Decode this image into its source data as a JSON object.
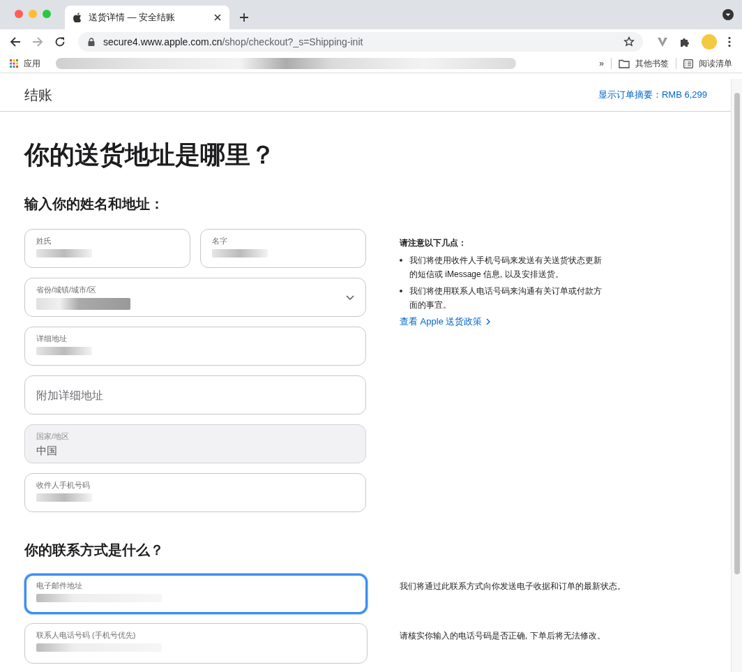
{
  "browser": {
    "tab": {
      "title": "送货详情 — 安全结账",
      "selected": true
    },
    "url": {
      "host": "secure4.www.apple.com.cn",
      "path": "/shop/checkout?_s=Shipping-init"
    },
    "bookmarks": {
      "apps": "应用",
      "overflow": "»",
      "other": "其他书签",
      "reading_list": "阅读清单"
    }
  },
  "header": {
    "title": "结账",
    "summary_link": "显示订单摘要：RMB 6,299"
  },
  "page_title": "你的送货地址是哪里？",
  "address_section": {
    "heading": "输入你的姓名和地址：",
    "name_fields": [
      {
        "label": "姓氏",
        "redacted": true,
        "focused": false,
        "disabled": false
      },
      {
        "label": "名字",
        "redacted": true,
        "focused": false,
        "disabled": false
      }
    ],
    "fields": [
      {
        "label": "省份/城镇/城市/区",
        "kind": "select",
        "redacted": true,
        "focused": false,
        "disabled": false
      },
      {
        "label": "详细地址",
        "kind": "text",
        "redacted": true,
        "focused": false,
        "disabled": false
      },
      {
        "placeholder": "附加详细地址",
        "kind": "text",
        "redacted": false,
        "focused": false,
        "disabled": false
      },
      {
        "label": "国家/地区",
        "value": "中国",
        "kind": "text",
        "redacted": false,
        "focused": false,
        "disabled": true
      },
      {
        "label": "收件人手机号码",
        "kind": "text",
        "redacted": true,
        "focused": false,
        "disabled": false
      }
    ],
    "notes": {
      "heading": "请注意以下几点：",
      "items": [
        "我们将使用收件人手机号码来发送有关送货状态更新的短信或 iMessage 信息, 以及安排送货。",
        "我们将使用联系人电话号码来沟通有关订单或付款方面的事宜。"
      ],
      "link": "查看 Apple 送货政策"
    }
  },
  "contact_section": {
    "heading": "你的联系方式是什么？",
    "rows": [
      {
        "field": {
          "label": "电子邮件地址",
          "redacted": true,
          "focused": true,
          "disabled": false
        },
        "note": "我们将通过此联系方式向你发送电子收据和订单的最新状态。"
      },
      {
        "field": {
          "label": "联系人电话号码 (手机号优先)",
          "redacted": true,
          "focused": false,
          "disabled": false
        },
        "note": "请核实你输入的电话号码是否正确, 下单后将无法修改。"
      }
    ]
  }
}
